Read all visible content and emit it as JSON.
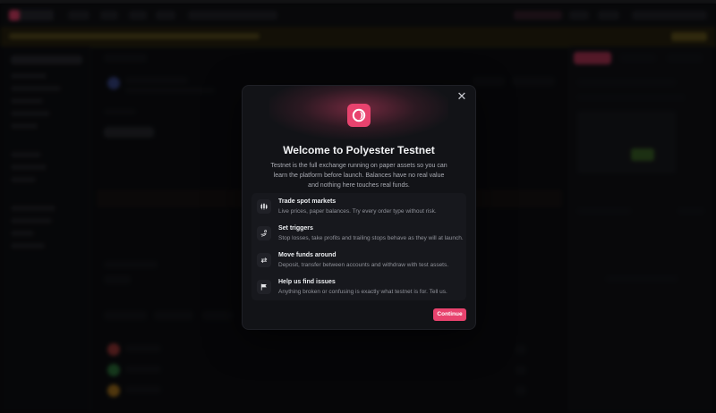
{
  "modal": {
    "close_symbol": "✕",
    "title": "Welcome to Polyester Testnet",
    "description": "Testnet is the full exchange running on paper assets so you can learn the platform before launch. Balances have no real value and nothing here touches real funds.",
    "features": [
      {
        "icon": "candlestick-chart-icon",
        "title": "Trade spot markets",
        "desc": "Live prices, paper balances. Try every order type without risk."
      },
      {
        "icon": "trigger-hand-icon",
        "title": "Set triggers",
        "desc": "Stop losses, take profits and trailing stops behave as they will at launch."
      },
      {
        "icon": "transfer-arrows-icon",
        "title": "Move funds around",
        "desc": "Deposit, transfer between accounts and withdraw with test assets."
      },
      {
        "icon": "flag-icon",
        "title": "Help us find issues",
        "desc": "Anything broken or confusing is exactly what testnet is for. Tell us."
      }
    ],
    "continue_label": "Continue"
  },
  "colors": {
    "accent": "#e8436e",
    "modal_bg": "#121317",
    "feature_bg": "#17181d",
    "page_bg": "#0b0c0f"
  }
}
